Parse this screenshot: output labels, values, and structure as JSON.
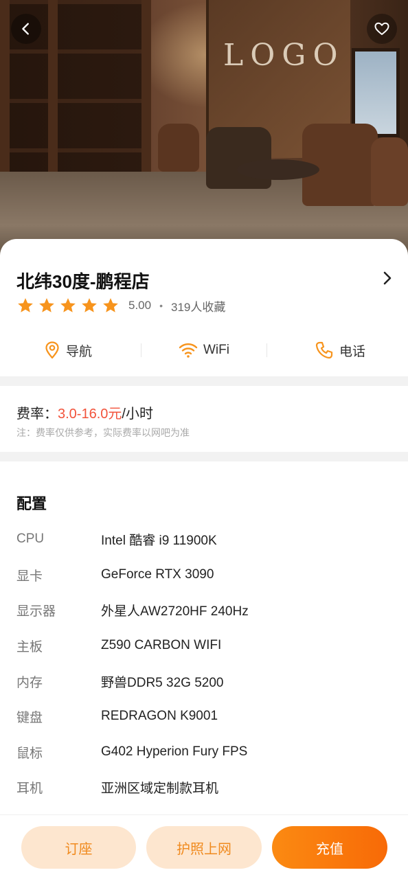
{
  "shop": {
    "name": "北纬30度-鹏程店",
    "rating": "5.00",
    "rating_stars": 5,
    "favorites": "319人收藏",
    "hero_logo_text": "LOGO"
  },
  "actions": {
    "navigate": "导航",
    "wifi": "WiFi",
    "phone": "电话"
  },
  "pricing": {
    "label": "费率：",
    "rate": "3.0-16.0元",
    "unit": "/小时",
    "note": "注：费率仅供参考，实际费率以网吧为准"
  },
  "config": {
    "title": "配置",
    "items": [
      {
        "label": "CPU",
        "value": "Intel 酷睿 i9 11900K"
      },
      {
        "label": "显卡",
        "value": "GeForce RTX 3090"
      },
      {
        "label": "显示器",
        "value": "外星人AW2720HF 240Hz"
      },
      {
        "label": "主板",
        "value": "Z590 CARBON WIFI"
      },
      {
        "label": "内存",
        "value": "野兽DDR5 32G 5200"
      },
      {
        "label": "键盘",
        "value": "REDRAGON K9001"
      },
      {
        "label": "鼠标",
        "value": "G402 Hyperion Fury FPS"
      },
      {
        "label": "耳机",
        "value": "亚洲区域定制款耳机"
      }
    ]
  },
  "bottom": {
    "reserve": "订座",
    "passport": "护照上网",
    "recharge": "充值"
  },
  "icons": {
    "back": "back-arrow-icon",
    "favorite": "heart-icon",
    "more": "chevron-right-icon",
    "star": "star-icon",
    "navigate": "location-pin-icon",
    "wifi": "wifi-icon",
    "phone": "phone-icon"
  },
  "colors": {
    "accent": "#f7941d",
    "price": "#f2523a",
    "button_light": "#fde6cf",
    "button_primary": "#fb7c0e"
  }
}
